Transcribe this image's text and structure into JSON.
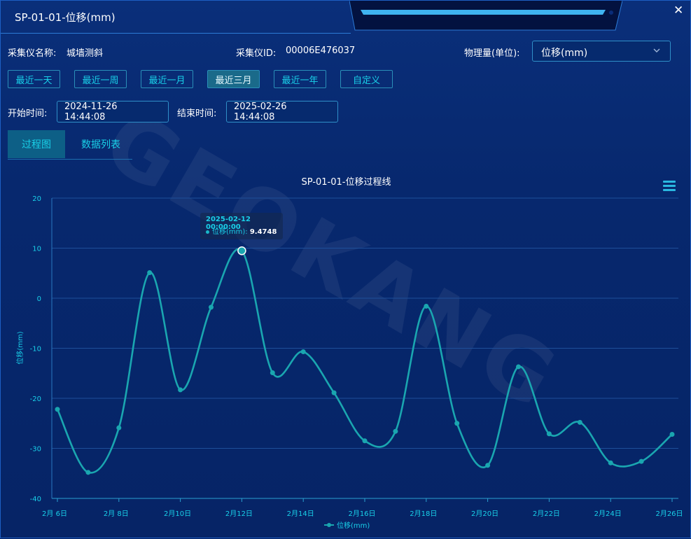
{
  "window": {
    "title": "SP-01-01-位移(mm)",
    "close_label": "✕"
  },
  "info": {
    "collector_name_label": "采集仪名称:",
    "collector_name_value": "城墙测斜",
    "collector_id_label": "采集仪ID:",
    "collector_id_value": "00006E476037",
    "quantity_label": "物理量(单位):",
    "quantity_value": "位移(mm)"
  },
  "ranges": [
    "最近一天",
    "最近一周",
    "最近一月",
    "最近三月",
    "最近一年",
    "自定义"
  ],
  "active_range": "最近三月",
  "time": {
    "start_label": "开始时间:",
    "start_value": "2024-11-26 14:44:08",
    "end_label": "结束时间:",
    "end_value": "2025-02-26 14:44:08"
  },
  "tabs": [
    "过程图",
    "数据列表"
  ],
  "active_tab": "过程图",
  "colors": {
    "accent": "#19d0e8",
    "series": "#1aa6b0",
    "background": "#07286e"
  },
  "icons": {
    "menu": "menu-icon",
    "close": "close-icon",
    "dropdown": "chevron-down-icon"
  },
  "tooltip": {
    "date": "2025-02-12 00:00:00",
    "series": "位移(mm):",
    "value": "9.4748"
  },
  "chart_data": {
    "type": "line",
    "title": "SP-01-01-位移过程线",
    "ylabel": "位移(mm)",
    "xlabel": "",
    "ylim": [
      -40,
      20
    ],
    "yticks": [
      20,
      10,
      0,
      -10,
      -20,
      -30,
      -40
    ],
    "xticks": [
      "2月 6日",
      "2月 8日",
      "2月10日",
      "2月12日",
      "2月14日",
      "2月16日",
      "2月18日",
      "2月20日",
      "2月22日",
      "2月24日",
      "2月26日"
    ],
    "x": [
      "2025-02-06",
      "2025-02-07",
      "2025-02-08",
      "2025-02-09",
      "2025-02-10",
      "2025-02-11",
      "2025-02-12",
      "2025-02-13",
      "2025-02-14",
      "2025-02-15",
      "2025-02-16",
      "2025-02-17",
      "2025-02-18",
      "2025-02-19",
      "2025-02-20",
      "2025-02-21",
      "2025-02-22",
      "2025-02-23",
      "2025-02-24",
      "2025-02-25",
      "2025-02-26"
    ],
    "series": [
      {
        "name": "位移(mm)",
        "values": [
          -22.2,
          -34.8,
          -25.9,
          5.1,
          -18.3,
          -1.8,
          9.4748,
          -14.9,
          -10.7,
          -18.9,
          -28.5,
          -26.6,
          -1.6,
          -25.0,
          -33.4,
          -13.7,
          -27.1,
          -24.8,
          -32.9,
          -32.6,
          -27.2
        ]
      }
    ],
    "highlight_index": 6,
    "legend": "bottom",
    "grid": true
  }
}
